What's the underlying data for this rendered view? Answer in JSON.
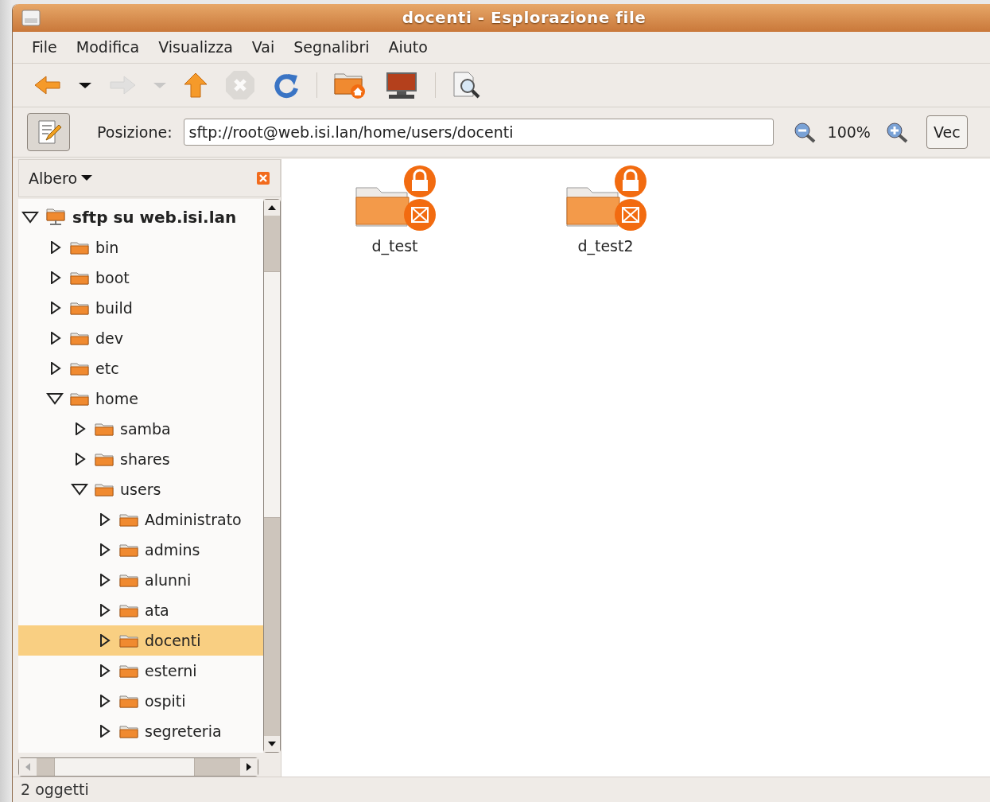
{
  "window": {
    "title": "docenti - Esplorazione file"
  },
  "menu": [
    "File",
    "Modifica",
    "Visualizza",
    "Vai",
    "Segnalibri",
    "Aiuto"
  ],
  "toolbar": [
    {
      "kind": "back",
      "disabled": false
    },
    {
      "kind": "dropdown",
      "disabled": false
    },
    {
      "kind": "forward",
      "disabled": true
    },
    {
      "kind": "dropdown",
      "disabled": true
    },
    {
      "kind": "up",
      "disabled": false
    },
    {
      "kind": "stop",
      "disabled": true
    },
    {
      "kind": "reload",
      "disabled": false
    },
    {
      "kind": "separator"
    },
    {
      "kind": "home"
    },
    {
      "kind": "computer"
    },
    {
      "kind": "separator"
    },
    {
      "kind": "search"
    }
  ],
  "location": {
    "label": "Posizione:",
    "value": "sftp://root@web.isi.lan/home/users/docenti",
    "zoom": "100%",
    "view_button": "Vec"
  },
  "sidebar": {
    "title": "Albero",
    "tree": [
      {
        "label": "sftp su web.isi.lan",
        "kind": "server",
        "expanded": true,
        "selected": false,
        "children": [
          {
            "label": "bin",
            "kind": "folder",
            "expanded": false,
            "selected": false
          },
          {
            "label": "boot",
            "kind": "folder",
            "expanded": false,
            "selected": false
          },
          {
            "label": "build",
            "kind": "folder",
            "expanded": false,
            "selected": false
          },
          {
            "label": "dev",
            "kind": "folder",
            "expanded": false,
            "selected": false
          },
          {
            "label": "etc",
            "kind": "folder",
            "expanded": false,
            "selected": false
          },
          {
            "label": "home",
            "kind": "folder",
            "expanded": true,
            "selected": false,
            "children": [
              {
                "label": "samba",
                "kind": "folder",
                "expanded": false,
                "selected": false
              },
              {
                "label": "shares",
                "kind": "folder",
                "expanded": false,
                "selected": false
              },
              {
                "label": "users",
                "kind": "folder",
                "expanded": true,
                "selected": false,
                "children": [
                  {
                    "label": "Administrato",
                    "kind": "folder",
                    "expanded": false,
                    "selected": false
                  },
                  {
                    "label": "admins",
                    "kind": "folder",
                    "expanded": false,
                    "selected": false
                  },
                  {
                    "label": "alunni",
                    "kind": "folder",
                    "expanded": false,
                    "selected": false
                  },
                  {
                    "label": "ata",
                    "kind": "folder",
                    "expanded": false,
                    "selected": false
                  },
                  {
                    "label": "docenti",
                    "kind": "folder",
                    "expanded": false,
                    "selected": true
                  },
                  {
                    "label": "esterni",
                    "kind": "folder",
                    "expanded": false,
                    "selected": false
                  },
                  {
                    "label": "ospiti",
                    "kind": "folder",
                    "expanded": false,
                    "selected": false
                  },
                  {
                    "label": "segreteria",
                    "kind": "folder",
                    "expanded": false,
                    "selected": false
                  }
                ]
              }
            ]
          }
        ]
      }
    ]
  },
  "files": [
    {
      "name": "d_test"
    },
    {
      "name": "d_test2"
    }
  ],
  "status_bar": "2 oggetti"
}
